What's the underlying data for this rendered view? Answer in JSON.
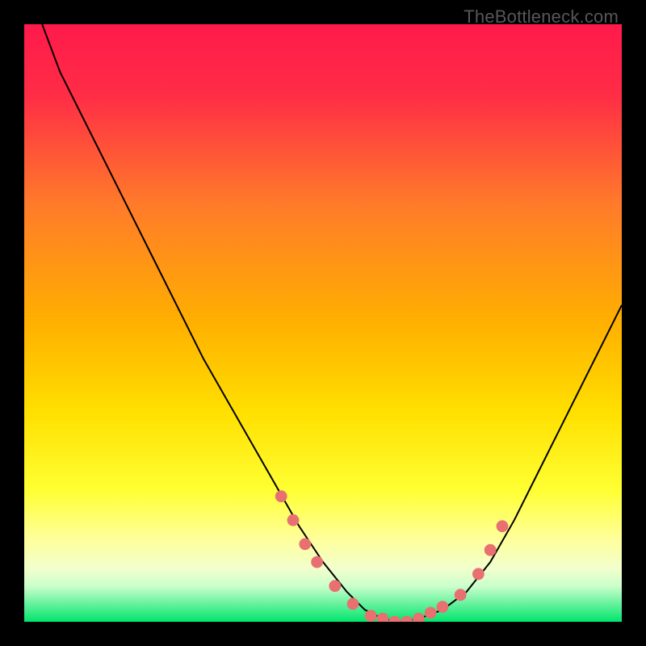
{
  "watermark": "TheBottleneck.com",
  "colors": {
    "gradient_top": "#ff1a4b",
    "gradient_mid1": "#ff7a2a",
    "gradient_mid2": "#ffd400",
    "gradient_low1": "#ffff66",
    "gradient_low2": "#f7ffb0",
    "gradient_bottom": "#00e56b",
    "curve": "#000000",
    "dot": "#e97070",
    "frame": "#000000"
  },
  "chart_data": {
    "type": "line",
    "title": "",
    "xlabel": "",
    "ylabel": "",
    "xlim": [
      0,
      100
    ],
    "ylim": [
      0,
      100
    ],
    "series": [
      {
        "name": "bottleneck-curve",
        "x": [
          3,
          6,
          10,
          14,
          18,
          22,
          26,
          30,
          34,
          38,
          42,
          46,
          50,
          54,
          57,
          60,
          63,
          66,
          70,
          74,
          78,
          82,
          86,
          90,
          94,
          98,
          100
        ],
        "values": [
          100,
          92,
          84,
          76,
          68,
          60,
          52,
          44,
          37,
          30,
          23,
          16,
          10,
          5,
          2,
          0.5,
          0,
          0.5,
          2,
          5,
          10,
          17,
          25,
          33,
          41,
          49,
          53
        ]
      }
    ],
    "dots": {
      "name": "highlight-dots",
      "x": [
        43,
        45,
        47,
        49,
        52,
        55,
        58,
        60,
        62,
        64,
        66,
        68,
        70,
        73,
        76,
        78,
        80
      ],
      "values": [
        21,
        17,
        13,
        10,
        6,
        3,
        1,
        0.5,
        0,
        0,
        0.5,
        1.5,
        2.5,
        4.5,
        8,
        12,
        16
      ]
    },
    "annotations": []
  }
}
